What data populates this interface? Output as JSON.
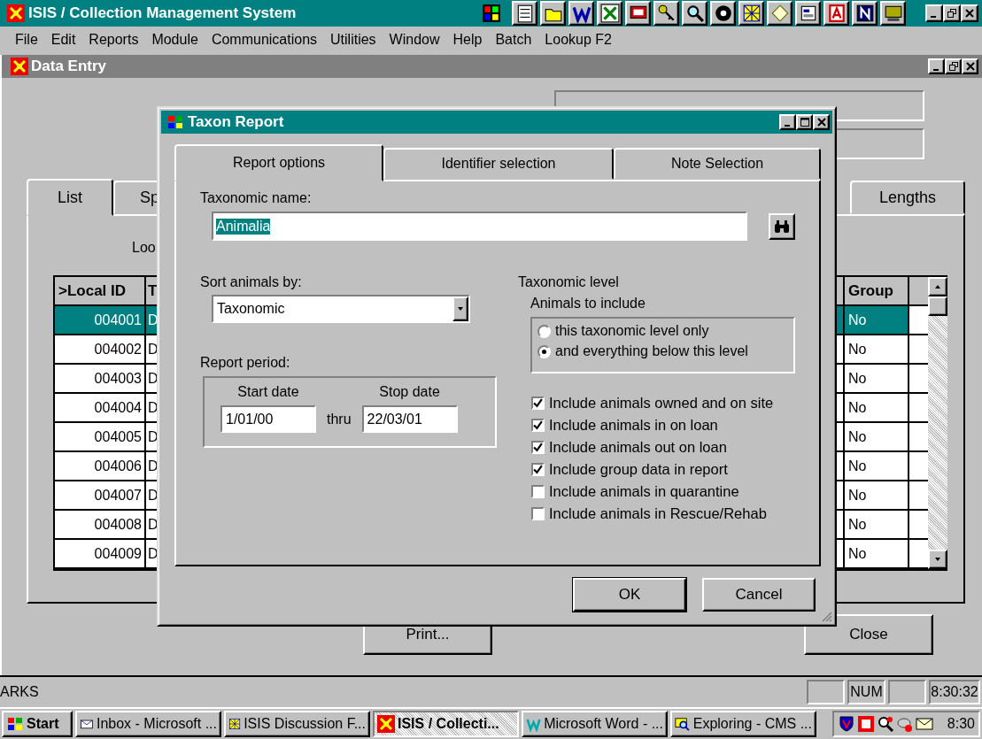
{
  "app_window": {
    "title": "ISIS / Collection Management System"
  },
  "menu": [
    "File",
    "Edit",
    "Reports",
    "Module",
    "Communications",
    "Utilities",
    "Window",
    "Help",
    "Batch",
    "Lookup F2"
  ],
  "data_entry": {
    "title": "Data Entry",
    "tabs": [
      {
        "label": "List",
        "selected": true
      },
      {
        "label": "Sp",
        "selected": false
      },
      {
        "label": "Lengths",
        "selected": false
      }
    ],
    "lookup_label": "Loo",
    "table": {
      "columns": [
        ">Local ID",
        "T",
        "Group"
      ],
      "rows": [
        {
          "local_id": "004001",
          "column_2": "D",
          "group": "No",
          "selected": true
        },
        {
          "local_id": "004002",
          "column_2": "D",
          "group": "No",
          "selected": false
        },
        {
          "local_id": "004003",
          "column_2": "D",
          "group": "No",
          "selected": false
        },
        {
          "local_id": "004004",
          "column_2": "D",
          "group": "No",
          "selected": false
        },
        {
          "local_id": "004005",
          "column_2": "D",
          "group": "No",
          "selected": false
        },
        {
          "local_id": "004006",
          "column_2": "D",
          "group": "No",
          "selected": false
        },
        {
          "local_id": "004007",
          "column_2": "D",
          "group": "No",
          "selected": false
        },
        {
          "local_id": "004008",
          "column_2": "D",
          "group": "No",
          "selected": false
        },
        {
          "local_id": "004009",
          "column_2": "D",
          "group": "No",
          "selected": false
        }
      ]
    },
    "buttons": [
      "Print...",
      "Close"
    ]
  },
  "dialog": {
    "title": "Taxon Report",
    "tabs": [
      {
        "label": "Report options",
        "selected": true
      },
      {
        "label": "Identifier selection",
        "selected": false
      },
      {
        "label": "Note Selection",
        "selected": false
      }
    ],
    "taxonomic_name": {
      "label": "Taxonomic name:",
      "value": "Animalia",
      "value_selected": true
    },
    "sort": {
      "label": "Sort animals by:",
      "value": "Taxonomic"
    },
    "report_period": {
      "label": "Report period:",
      "start_label": "Start date",
      "start_value": "1/01/00",
      "thru": "thru",
      "stop_label": "Stop date",
      "stop_value": "22/03/01"
    },
    "taxonomic_level": {
      "label": "Taxonomic level",
      "sublabel": "Animals to include",
      "options": [
        {
          "label": "this taxonomic level only",
          "selected": false
        },
        {
          "label": "and everything below this level",
          "selected": true
        }
      ]
    },
    "includes": [
      {
        "label": "Include animals owned and on site",
        "checked": true
      },
      {
        "label": "Include animals in on loan",
        "checked": true
      },
      {
        "label": "Include animals out on loan",
        "checked": true
      },
      {
        "label": "Include group data in report",
        "checked": true
      },
      {
        "label": "Include animals in quarantine",
        "checked": false
      },
      {
        "label": "Include animals in Rescue/Rehab",
        "checked": false
      }
    ],
    "buttons": [
      {
        "label": "OK",
        "default": true
      },
      {
        "label": "Cancel",
        "default": false
      }
    ]
  },
  "status_bar": {
    "text": "ARKS",
    "num_indicator": "NUM",
    "clock": "8:30:32"
  },
  "taskbar": {
    "start": "Start",
    "tasks": [
      {
        "label": "Inbox - Microsoft ...",
        "kind": "mail",
        "selected": false
      },
      {
        "label": "ISIS Discussion F...",
        "kind": "forum",
        "selected": false
      },
      {
        "label": "ISIS / Collecti...",
        "kind": "isis",
        "selected": true
      },
      {
        "label": "Microsoft Word - ...",
        "kind": "word",
        "selected": false
      },
      {
        "label": "Exploring - CMS ...",
        "kind": "explorer",
        "selected": false
      }
    ],
    "clock": "8:30"
  }
}
